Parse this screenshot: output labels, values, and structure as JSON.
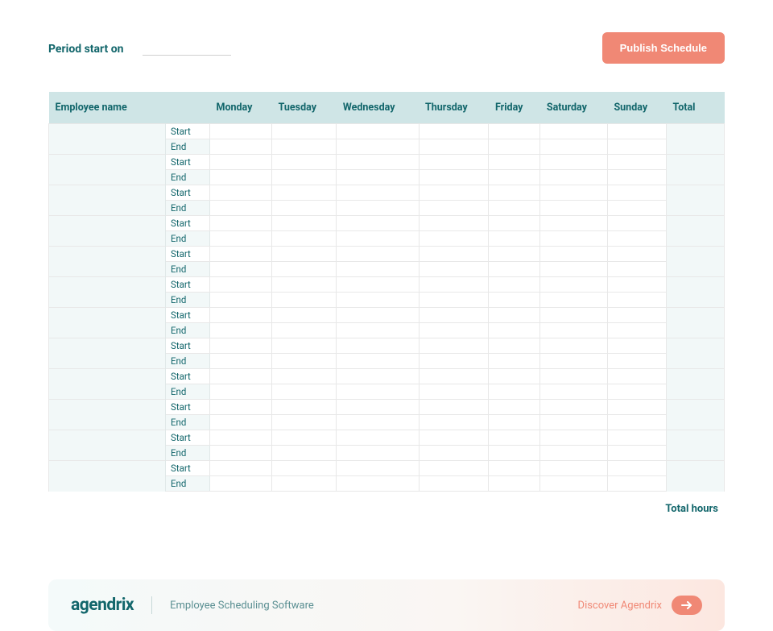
{
  "header": {
    "period_label": "Period start on",
    "period_value": "",
    "publish_button_label": "Publish Schedule"
  },
  "table": {
    "columns": {
      "employee": "Employee name",
      "label_col": "",
      "days": [
        "Monday",
        "Tuesday",
        "Wednesday",
        "Thursday",
        "Friday",
        "Saturday",
        "Sunday"
      ],
      "total": "Total"
    },
    "row_labels": {
      "start": "Start",
      "end": "End"
    },
    "employees": [
      {
        "name": ""
      },
      {
        "name": ""
      },
      {
        "name": ""
      },
      {
        "name": ""
      },
      {
        "name": ""
      },
      {
        "name": ""
      },
      {
        "name": ""
      },
      {
        "name": ""
      },
      {
        "name": ""
      },
      {
        "name": ""
      },
      {
        "name": ""
      },
      {
        "name": ""
      }
    ],
    "total_hours_label": "Total hours"
  },
  "footer": {
    "logo_text": "agendrix",
    "tagline": "Employee Scheduling Software",
    "discover_label": "Discover Agendrix"
  }
}
